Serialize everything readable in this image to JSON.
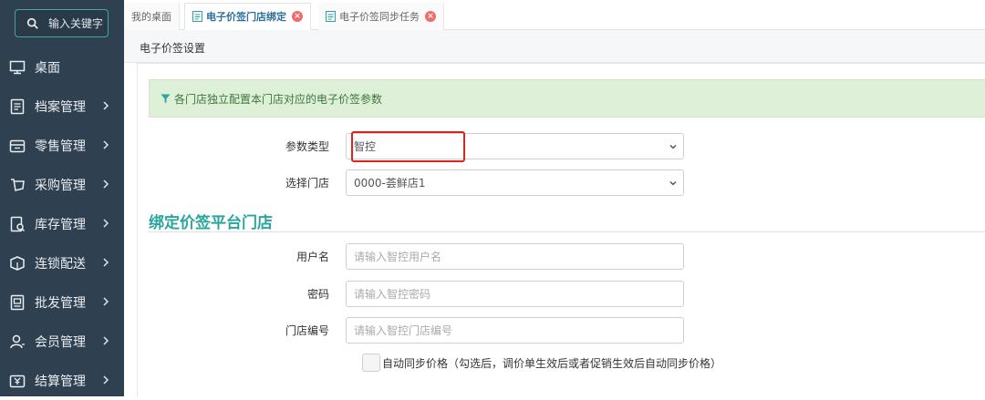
{
  "search": {
    "placeholder": "输入关键字"
  },
  "sidebar": {
    "items": [
      {
        "label": "桌面",
        "icon": "monitor-icon",
        "chevron": false
      },
      {
        "label": "档案管理",
        "icon": "archive-icon",
        "chevron": true
      },
      {
        "label": "零售管理",
        "icon": "retail-icon",
        "chevron": true
      },
      {
        "label": "采购管理",
        "icon": "purchase-icon",
        "chevron": true
      },
      {
        "label": "库存管理",
        "icon": "inventory-icon",
        "chevron": true
      },
      {
        "label": "连锁配送",
        "icon": "delivery-icon",
        "chevron": true
      },
      {
        "label": "批发管理",
        "icon": "wholesale-icon",
        "chevron": true
      },
      {
        "label": "会员管理",
        "icon": "member-icon",
        "chevron": true
      },
      {
        "label": "结算管理",
        "icon": "settlement-icon",
        "chevron": true
      }
    ]
  },
  "tabs": [
    {
      "label": "我的桌面",
      "active": false,
      "closable": false
    },
    {
      "label": "电子价签门店绑定",
      "active": true,
      "closable": true
    },
    {
      "label": "电子价签同步任务",
      "active": false,
      "closable": true
    }
  ],
  "breadcrumb": "电子价签设置",
  "notice": "各门店独立配置本门店对应的电子价签参数",
  "form": {
    "param_type_label": "参数类型",
    "param_type_value": "智控",
    "store_label": "选择门店",
    "store_value": "0000-荟鲜店1",
    "section_title": "绑定价签平台门店",
    "username_label": "用户名",
    "username_placeholder": "请输入智控用户名",
    "password_label": "密码",
    "password_placeholder": "请输入智控密码",
    "store_code_label": "门店编号",
    "store_code_placeholder": "请输入智控门店编号",
    "auto_sync_label": "自动同步价格（勾选后，调价单生效后或者促销生效后自动同步价格）"
  },
  "colors": {
    "sidebar": "#2f4050",
    "accent": "#2aa5a0",
    "highlight": "#e0231c",
    "notice_bg": "#dff0d8"
  }
}
